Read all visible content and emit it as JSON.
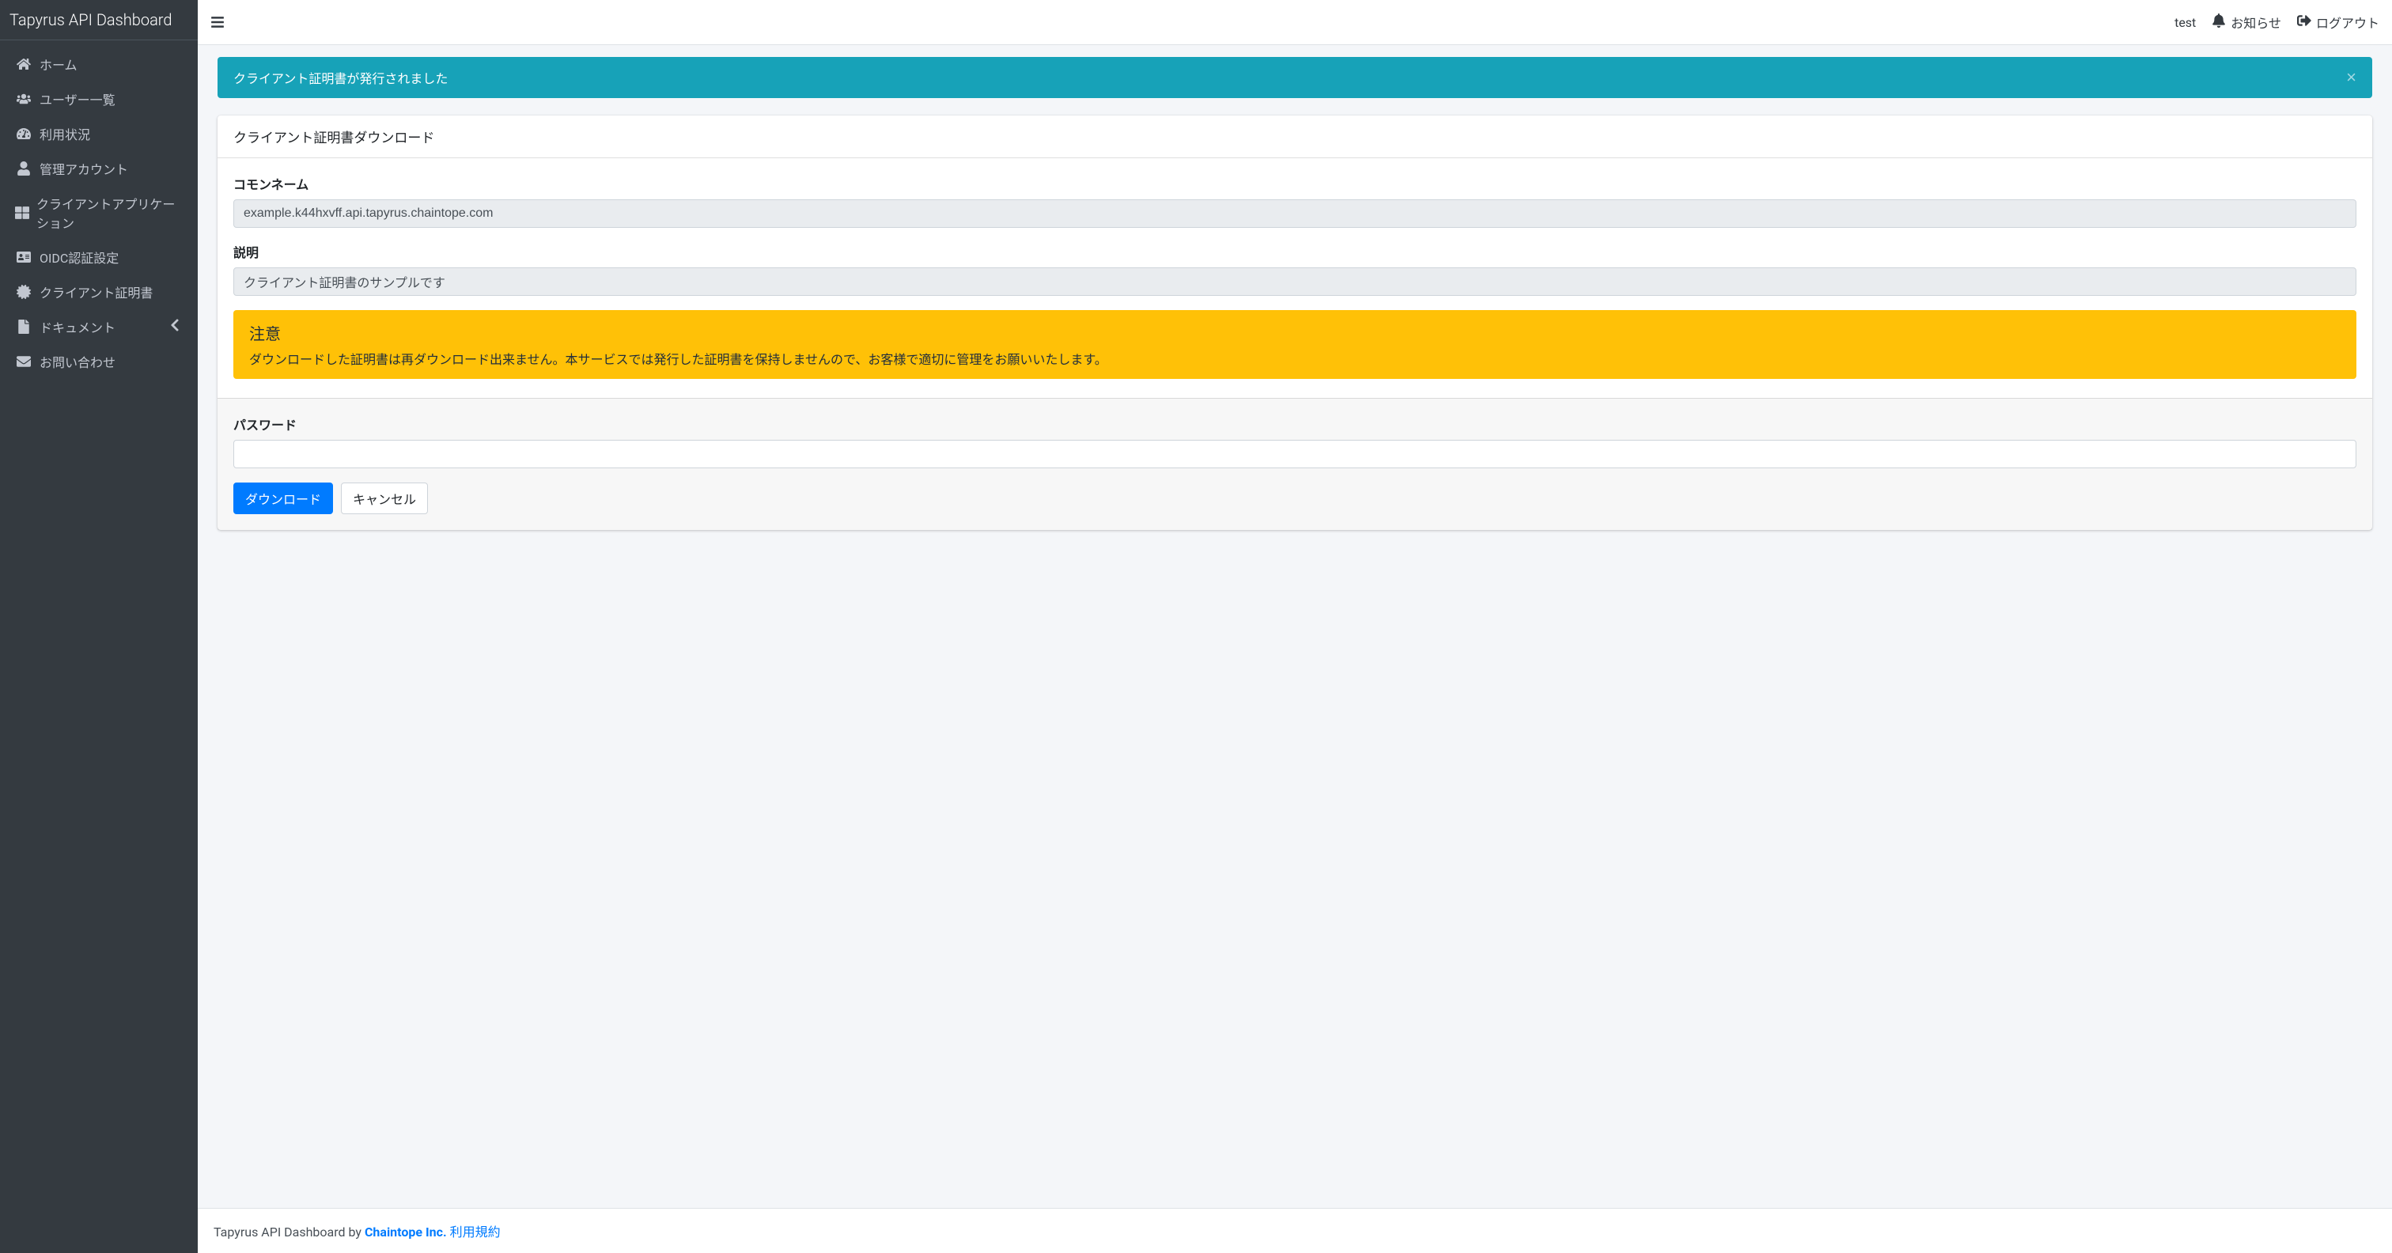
{
  "brand": "Tapyrus API Dashboard",
  "sidebar": {
    "items": [
      {
        "label": "ホーム",
        "icon": "home-icon"
      },
      {
        "label": "ユーザー一覧",
        "icon": "users-icon"
      },
      {
        "label": "利用状況",
        "icon": "tachometer-icon"
      },
      {
        "label": "管理アカウント",
        "icon": "user-icon"
      },
      {
        "label": "クライアントアプリケーション",
        "icon": "th-large-icon"
      },
      {
        "label": "OIDC認証設定",
        "icon": "id-card-icon"
      },
      {
        "label": "クライアント証明書",
        "icon": "certificate-icon"
      },
      {
        "label": "ドキュメント",
        "icon": "file-icon",
        "has_children": true
      },
      {
        "label": "お問い合わせ",
        "icon": "envelope-icon"
      }
    ]
  },
  "topbar": {
    "user": "test",
    "news": "お知らせ",
    "logout": "ログアウト"
  },
  "alert": {
    "message": "クライアント証明書が発行されました"
  },
  "card": {
    "title": "クライアント証明書ダウンロード",
    "common_name_label": "コモンネーム",
    "common_name_value": "example.k44hxvff.api.tapyrus.chaintope.com",
    "description_label": "説明",
    "description_value": "クライアント証明書のサンプルです",
    "warning_title": "注意",
    "warning_body": "ダウンロードした証明書は再ダウンロード出来ません。本サービスでは発行した証明書を保持しませんので、お客様で適切に管理をお願いいたします。",
    "password_label": "パスワード",
    "download_button": "ダウンロード",
    "cancel_button": "キャンセル"
  },
  "footer": {
    "prefix": "Tapyrus API Dashboard by ",
    "link": "Chaintope Inc.",
    "terms": "利用規約"
  }
}
